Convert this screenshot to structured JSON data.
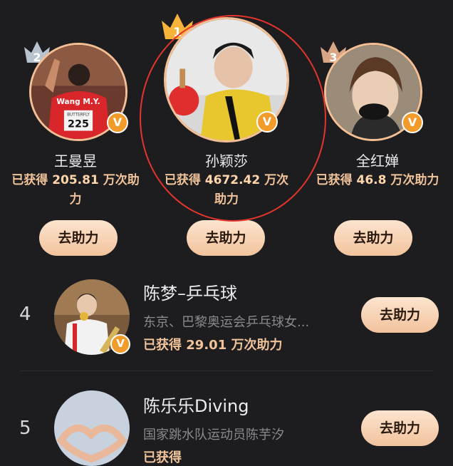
{
  "top3": [
    {
      "rank_label": "2",
      "name": "王曼昱",
      "score_prefix": "已获得 ",
      "score_value": "205.81",
      "score_suffix": " 万次助力",
      "button": "去助力"
    },
    {
      "rank_label": "1",
      "name": "孙颖莎",
      "score_prefix": "已获得 ",
      "score_value": "4672.42",
      "score_suffix": " 万次助力",
      "button": "去助力"
    },
    {
      "rank_label": "3",
      "name": "全红婵",
      "score_prefix": "已获得 ",
      "score_value": "46.8",
      "score_suffix": " 万次助力",
      "button": "去助力"
    }
  ],
  "list": [
    {
      "rank": "4",
      "title": "陈梦–乒乓球",
      "desc": "东京、巴黎奥运会乒乓球女...",
      "score_prefix": "已获得 ",
      "score_value": "29.01",
      "score_suffix": " 万次助力",
      "button": "去助力"
    },
    {
      "rank": "5",
      "title": "陈乐乐Diving",
      "desc": "国家跳水队运动员陈芋汐",
      "score_prefix": "已获得 ",
      "score_value": "",
      "score_suffix": "",
      "button": "去助力"
    }
  ],
  "athlete_jersey": {
    "name": "Wang M.Y.",
    "brand": "BUTTERFLY",
    "number": "225"
  },
  "verified_glyph": "V",
  "colors": {
    "background": "#1d1d1f",
    "accent": "#f1c39a",
    "button": "#f2c39d",
    "verified": "#f19b2a",
    "annotation": "#e3342d"
  }
}
